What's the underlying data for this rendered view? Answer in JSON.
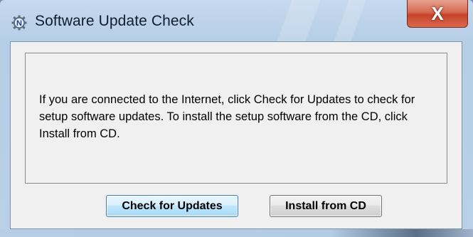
{
  "window": {
    "title": "Software Update Check",
    "icon": "n-gear-app-icon",
    "close_label": "X"
  },
  "message": {
    "text": "If you are connected to the Internet, click Check for Updates to check for setup software updates. To install the setup software from the CD, click Install from CD."
  },
  "buttons": {
    "check_updates": "Check for Updates",
    "install_cd": "Install from CD"
  },
  "colors": {
    "title_bar": "#b9d0e8",
    "close_button": "#c7432a",
    "client_bg": "#f0f0f0",
    "default_button_border": "#3c7fb1"
  }
}
